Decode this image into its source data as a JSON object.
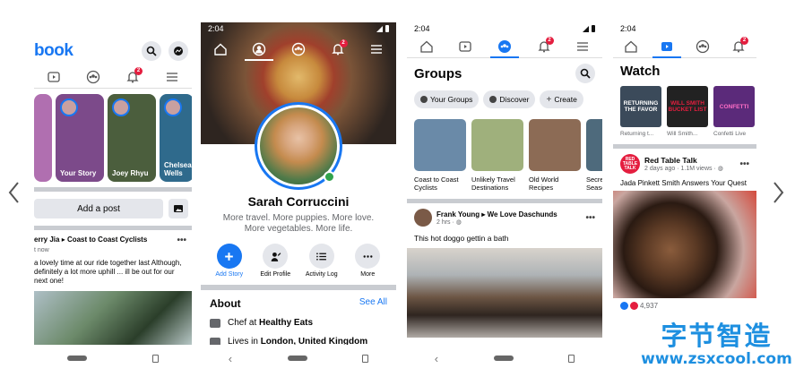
{
  "carousel": {
    "prev_icon": "chevron-left-icon",
    "next_icon": "chevron-right-icon"
  },
  "phone1": {
    "logo": "book",
    "tabs": [
      {
        "icon": "video-icon"
      },
      {
        "icon": "groups-icon"
      },
      {
        "icon": "bell-icon",
        "badge": "2"
      },
      {
        "icon": "menu-icon"
      }
    ],
    "stories": [
      {
        "label": "",
        "color": "#b06fb0"
      },
      {
        "label": "Your Story",
        "color": "#7c4a8a"
      },
      {
        "label": "Joey Rhyu",
        "color": "#4b5e3d"
      },
      {
        "label": "Chelsea Wells",
        "color": "#2f6a8c"
      }
    ],
    "add_post": "Add a post",
    "post": {
      "author": "erry Jia",
      "group": "Coast to Coast Cyclists",
      "time": "t now",
      "text": "a lovely time at our ride together last Although, definitely a lot more uphill ... ill be out for our next one!"
    }
  },
  "phone2": {
    "time": "2:04",
    "tabs": [
      {
        "icon": "home-icon"
      },
      {
        "icon": "profile-icon"
      },
      {
        "icon": "groups-icon"
      },
      {
        "icon": "bell-icon",
        "badge": "2"
      },
      {
        "icon": "menu-icon"
      }
    ],
    "name": "Sarah Corruccini",
    "bio": "More travel. More puppies. More love. More vegetables. More life.",
    "actions": [
      {
        "label": "Add Story",
        "icon": "plus-icon"
      },
      {
        "label": "Edit Profile",
        "icon": "edit-icon"
      },
      {
        "label": "Activity Log",
        "icon": "list-icon"
      },
      {
        "label": "More",
        "icon": "more-icon"
      }
    ],
    "about": {
      "title": "About",
      "see_all": "See All",
      "rows": [
        {
          "prefix": "Chef at ",
          "value": "Healthy Eats"
        },
        {
          "prefix": "Lives in ",
          "value": "London, United Kingdom"
        }
      ]
    }
  },
  "phone3": {
    "time": "2:04",
    "tabs": [
      {
        "icon": "home-icon"
      },
      {
        "icon": "video-icon"
      },
      {
        "icon": "groups-icon"
      },
      {
        "icon": "bell-icon",
        "badge": "2"
      },
      {
        "icon": "menu-icon"
      }
    ],
    "title": "Groups",
    "chips": [
      "Your Groups",
      "Discover",
      "Create"
    ],
    "groups": [
      {
        "name": "Coast to Coast Cyclists",
        "color": "#6a8aa8"
      },
      {
        "name": "Unlikely Travel Destinations",
        "color": "#9fb07c"
      },
      {
        "name": "Old World Recipes",
        "color": "#8c6b55"
      },
      {
        "name": "Secre Seaso",
        "color": "#4e6a7c"
      }
    ],
    "post": {
      "author": "Frank Young",
      "group": "We Love Daschunds",
      "time": "2 hrs",
      "text": "This hot doggo gettin a bath"
    }
  },
  "phone4": {
    "time": "2:04",
    "tabs": [
      {
        "icon": "home-icon"
      },
      {
        "icon": "video-icon"
      },
      {
        "icon": "groups-icon"
      },
      {
        "icon": "bell-icon",
        "badge": "2"
      }
    ],
    "title": "Watch",
    "shows": [
      {
        "name": "Returning t...",
        "art": "RETURNING THE FAVOR",
        "color": "#3b4a5a"
      },
      {
        "name": "Will Smith...",
        "art": "WILL SMITH BUCKET LIST",
        "color": "#222"
      },
      {
        "name": "Confetti Live",
        "art": "CONFETTI",
        "color": "#5b2a7a"
      }
    ],
    "post": {
      "page": "Red Table Talk",
      "logo_text": "RED TABLE TALK",
      "time": "2 days ago",
      "views": "1.1M views",
      "text": "Jada Pinkett Smith Answers Your Quest",
      "reactions": "4,937"
    }
  },
  "watermark": {
    "cn": "字节智造",
    "url": "www.zsxcool.com"
  }
}
